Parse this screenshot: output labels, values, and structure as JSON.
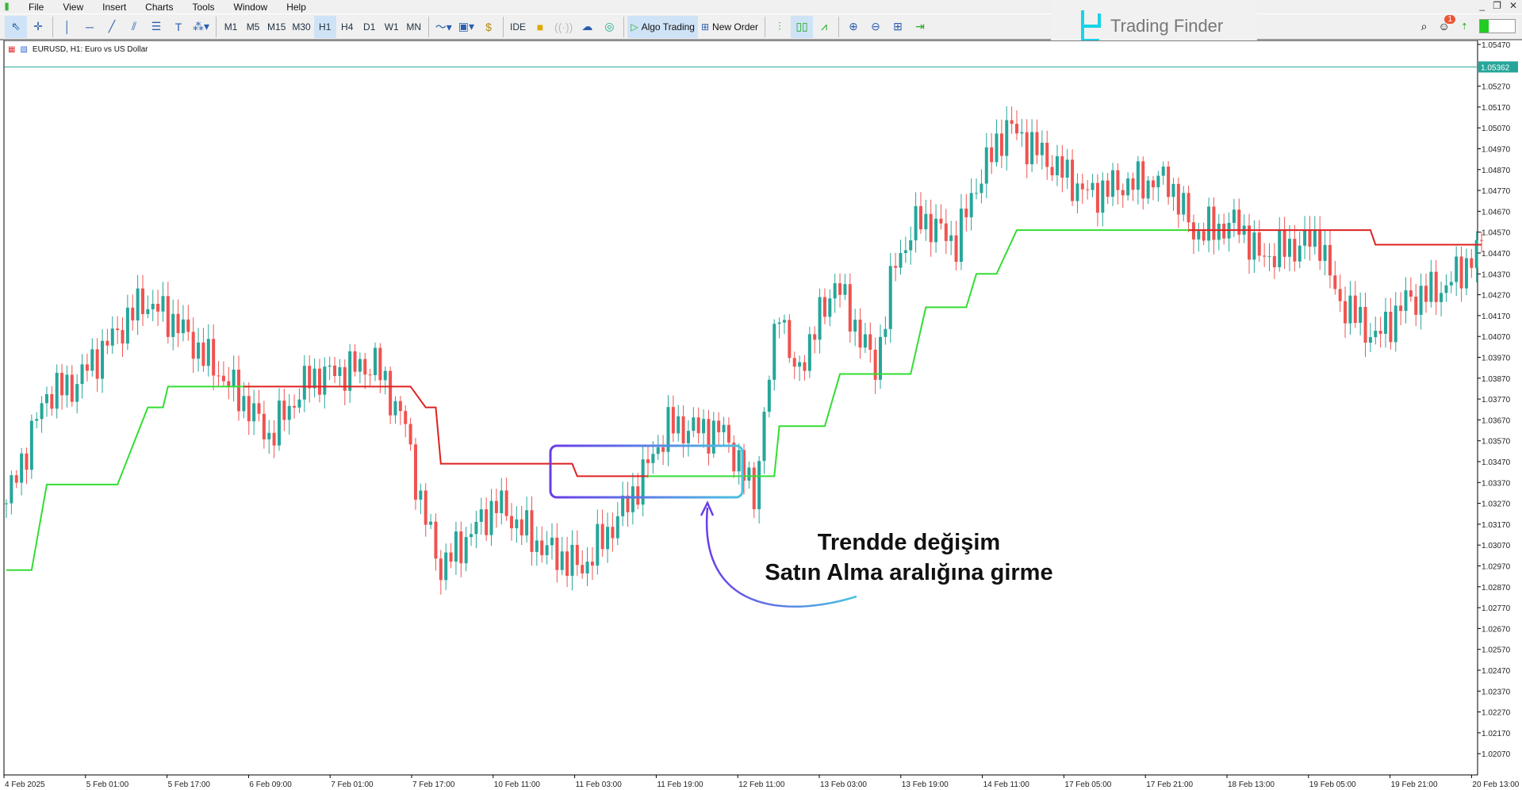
{
  "menu": {
    "items": [
      "File",
      "View",
      "Insert",
      "Charts",
      "Tools",
      "Window",
      "Help"
    ]
  },
  "window_controls": [
    "_",
    "❐",
    "✕"
  ],
  "toolbar": {
    "timeframes": [
      "M1",
      "M5",
      "M15",
      "M30",
      "H1",
      "H4",
      "D1",
      "W1",
      "MN"
    ],
    "selected_timeframe": "H1",
    "ide": "IDE",
    "algo_trading": "Algo Trading",
    "new_order": "New Order"
  },
  "watermark": {
    "brand": "Trading Finder"
  },
  "notifications": {
    "count": "1"
  },
  "chart": {
    "symbol_title": "EURUSD, H1:  Euro vs US Dollar",
    "current_price": "1.05362",
    "price_labels": [
      "1.05470",
      "1.05270",
      "1.05170",
      "1.05070",
      "1.04970",
      "1.04870",
      "1.04770",
      "1.04670",
      "1.04570",
      "1.04470",
      "1.04370",
      "1.04270",
      "1.04170",
      "1.04070",
      "1.03970",
      "1.03870",
      "1.03770",
      "1.03670",
      "1.03570",
      "1.03470",
      "1.03370",
      "1.03270",
      "1.03170",
      "1.03070",
      "1.02970",
      "1.02870",
      "1.02770",
      "1.02670",
      "1.02570",
      "1.02470",
      "1.02370",
      "1.02270",
      "1.02170",
      "1.02070"
    ],
    "time_labels": [
      "4 Feb 2025",
      "5 Feb 01:00",
      "5 Feb 17:00",
      "6 Feb 09:00",
      "7 Feb 01:00",
      "7 Feb 17:00",
      "10 Feb 11:00",
      "11 Feb 03:00",
      "11 Feb 19:00",
      "12 Feb 11:00",
      "13 Feb 03:00",
      "13 Feb 19:00",
      "14 Feb 11:00",
      "17 Feb 05:00",
      "17 Feb 21:00",
      "18 Feb 13:00",
      "19 Feb 05:00",
      "19 Feb 21:00",
      "20 Feb 13:00"
    ],
    "annotation": {
      "line1": "Trendde değişim",
      "line2": "Satın Alma aralığına girme"
    }
  },
  "chart_data": {
    "type": "candlestick",
    "ylim": [
      1.02,
      1.055
    ],
    "colors": {
      "bull": "#26a69a",
      "bear": "#ef5350",
      "buy_line": "#33dd33",
      "sell_line": "#dd2222",
      "current_price": "#26a69a"
    },
    "close_keypoints_by_bar": [
      [
        0,
        1.0327
      ],
      [
        8,
        1.038
      ],
      [
        13,
        1.0383
      ],
      [
        27,
        1.0424
      ],
      [
        33,
        1.0415
      ],
      [
        38,
        1.0401
      ],
      [
        48,
        1.0373
      ],
      [
        52,
        1.0359
      ],
      [
        60,
        1.0387
      ],
      [
        73,
        1.0394
      ],
      [
        79,
        1.0364
      ],
      [
        82,
        1.0327
      ],
      [
        86,
        1.0296
      ],
      [
        97,
        1.0327
      ],
      [
        106,
        1.0306
      ],
      [
        114,
        1.0296
      ],
      [
        123,
        1.0327
      ],
      [
        131,
        1.0364
      ],
      [
        142,
        1.0361
      ],
      [
        148,
        1.0331
      ],
      [
        153,
        1.0424
      ],
      [
        156,
        1.0387
      ],
      [
        164,
        1.0433
      ],
      [
        172,
        1.0392
      ],
      [
        176,
        1.0443
      ],
      [
        181,
        1.0464
      ],
      [
        188,
        1.0452
      ],
      [
        192,
        1.048
      ],
      [
        198,
        1.0508
      ],
      [
        206,
        1.0492
      ],
      [
        214,
        1.0475
      ],
      [
        221,
        1.048
      ],
      [
        230,
        1.0482
      ],
      [
        235,
        1.0457
      ],
      [
        244,
        1.0461
      ],
      [
        248,
        1.0445
      ],
      [
        260,
        1.0454
      ],
      [
        263,
        1.0427
      ],
      [
        271,
        1.0406
      ],
      [
        277,
        1.0424
      ],
      [
        285,
        1.0431
      ],
      [
        292,
        1.045
      ]
    ],
    "buy_line_by_bar": [
      [
        0,
        1.0295
      ],
      [
        5,
        1.0295
      ],
      [
        8,
        1.0336
      ],
      [
        22,
        1.0336
      ],
      [
        28,
        1.0373
      ],
      [
        31,
        1.0373
      ],
      [
        32,
        1.0383
      ],
      [
        48,
        1.0383
      ],
      null,
      [
        127,
        1.034
      ],
      [
        152,
        1.034
      ],
      [
        153,
        1.0364
      ],
      [
        162,
        1.0364
      ],
      [
        165,
        1.0389
      ],
      [
        179,
        1.0389
      ],
      [
        182,
        1.0421
      ],
      [
        190,
        1.0421
      ],
      [
        192,
        1.0437
      ],
      [
        196,
        1.0437
      ],
      [
        200,
        1.0458
      ],
      [
        234,
        1.0458
      ]
    ],
    "sell_line_by_bar": [
      [
        47,
        1.0383
      ],
      [
        80,
        1.0383
      ],
      [
        83,
        1.0373
      ],
      [
        85,
        1.0373
      ],
      [
        86,
        1.0346
      ],
      [
        112,
        1.0346
      ],
      [
        113,
        1.034
      ],
      [
        127,
        1.034
      ],
      null,
      [
        234,
        1.0458
      ],
      [
        270,
        1.0458
      ],
      [
        271,
        1.0451
      ],
      [
        292,
        1.0451
      ]
    ]
  }
}
